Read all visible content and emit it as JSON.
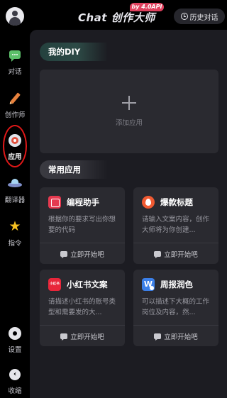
{
  "header": {
    "brand": "Chat 创作大师",
    "version_badge": "by 4.0API",
    "history_label": "历史对话"
  },
  "sidebar": {
    "items": [
      {
        "label": "对话",
        "icon": "chat-bubble-icon"
      },
      {
        "label": "创作师",
        "icon": "pencil-icon"
      },
      {
        "label": "应用",
        "icon": "app-target-icon",
        "active": true
      },
      {
        "label": "翻译器",
        "icon": "ufo-icon"
      },
      {
        "label": "指令",
        "icon": "star-icon"
      },
      {
        "label": "设置",
        "icon": "gear-icon"
      },
      {
        "label": "收缩",
        "icon": "collapse-icon"
      }
    ]
  },
  "main": {
    "diy_title": "我的DIY",
    "add_app_label": "添加应用",
    "common_title": "常用应用",
    "cards": [
      {
        "title": "编程助手",
        "desc": "根据你的要求写出你想要的代码",
        "start": "立即开始吧",
        "icon": "code-icon"
      },
      {
        "title": "爆款标题",
        "desc": "请输入文案内容，创作大师将为你创建...",
        "start": "立即开始吧",
        "icon": "fire-icon"
      },
      {
        "title": "小红书文案",
        "desc": "请描述小红书的账号类型和需要发的大...",
        "start": "立即开始吧",
        "icon": "xiaohongshu-icon",
        "icon_text": "小红书"
      },
      {
        "title": "周报润色",
        "desc": "可以描述下大概的工作岗位及内容，然...",
        "start": "立即开始吧",
        "icon": "word-doc-icon",
        "icon_text": "W"
      }
    ]
  },
  "colors": {
    "background": "#000000",
    "panel": "#1c1c22",
    "card": "#2a2a30",
    "badge": "#e0415e",
    "highlight_ring": "#e01818"
  }
}
